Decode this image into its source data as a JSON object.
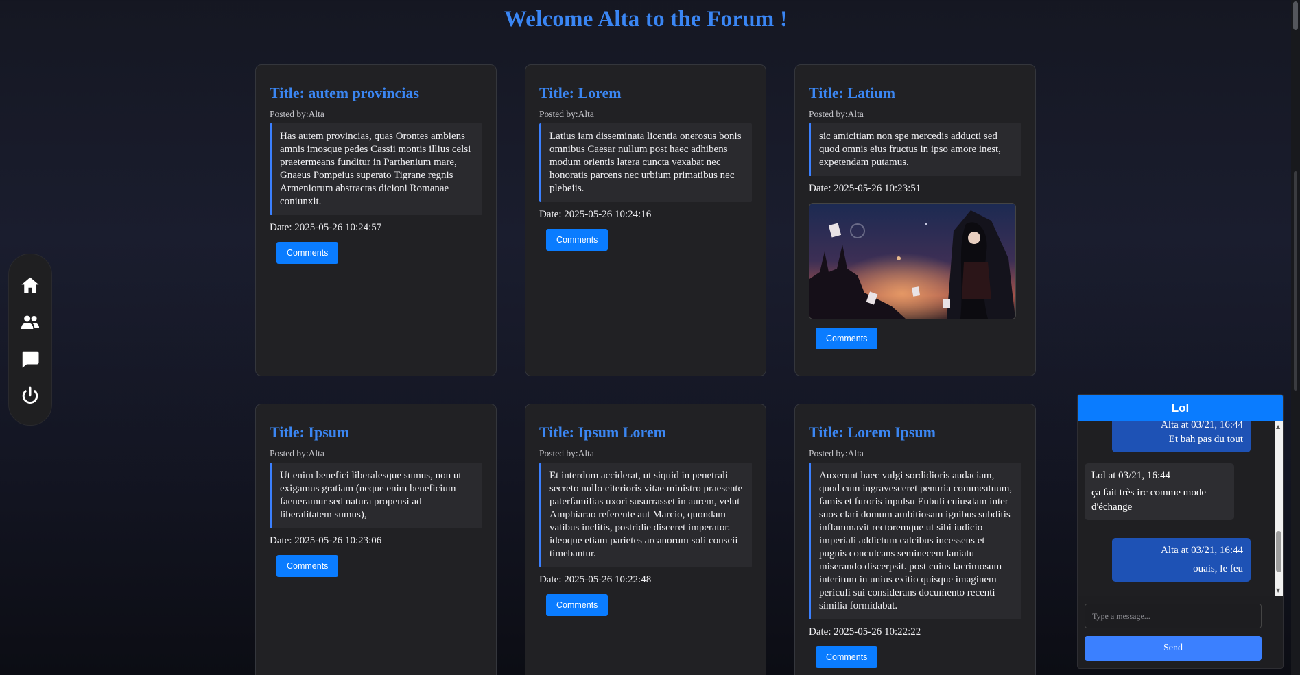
{
  "page": {
    "title": "Welcome Alta to the Forum !"
  },
  "sidebar": {
    "items": [
      {
        "icon": "home-icon"
      },
      {
        "icon": "users-icon"
      },
      {
        "icon": "chat-bubble-icon"
      },
      {
        "icon": "power-icon"
      }
    ]
  },
  "posts": [
    {
      "title": "Title: autem provincias",
      "author": "Posted by:Alta",
      "content": "Has autem provincias, quas Orontes ambiens amnis imosque pedes Cassii montis illius celsi praetermeans funditur in Parthenium mare, Gnaeus Pompeius superato Tigrane regnis Armeniorum abstractas dicioni Romanae coniunxit.",
      "date": "Date: 2025-05-26 10:24:57",
      "button": "Comments"
    },
    {
      "title": "Title: Lorem",
      "author": "Posted by:Alta",
      "content": "Latius iam disseminata licentia onerosus bonis omnibus Caesar nullum post haec adhibens modum orientis latera cuncta vexabat nec honoratis parcens nec urbium primatibus nec plebeiis.",
      "date": "Date: 2025-05-26 10:24:16",
      "button": "Comments"
    },
    {
      "title": "Title: Latium",
      "author": "Posted by:Alta",
      "content": "sic amicitiam non spe mercedis adducti sed quod omnis eius fructus in ipso amore inest, expetendam putamus.",
      "date": "Date: 2025-05-26 10:23:51",
      "button": "Comments"
    },
    {
      "title": "Title: Ipsum",
      "author": "Posted by:Alta",
      "content": "Ut enim benefici liberalesque sumus, non ut exigamus gratiam (neque enim beneficium faeneramur sed natura propensi ad liberalitatem sumus),",
      "date": "Date: 2025-05-26 10:23:06",
      "button": "Comments"
    },
    {
      "title": "Title: Ipsum Lorem",
      "author": "Posted by:Alta",
      "content": "Et interdum acciderat, ut siquid in penetrali secreto nullo citerioris vitae ministro praesente paterfamilias uxori susurrasset in aurem, velut Amphiarao referente aut Marcio, quondam vatibus inclitis, postridie disceret imperator. ideoque etiam parietes arcanorum soli conscii timebantur.",
      "date": "Date: 2025-05-26 10:22:48",
      "button": "Comments"
    },
    {
      "title": "Title: Lorem Ipsum",
      "author": "Posted by:Alta",
      "content": "Auxerunt haec vulgi sordidioris audaciam, quod cum ingravesceret penuria commeatuum, famis et furoris inpulsu Eubuli cuiusdam inter suos clari domum ambitiosam ignibus subditis inflammavit rectoremque ut sibi iudicio imperiali addictum calcibus incessens et pugnis conculcans seminecem laniatu miserando discerpsit. post cuius lacrimosum interitum in unius exitio quisque imaginem periculi sui considerans documento recenti similia formidabat.",
      "date": "Date: 2025-05-26 10:22:22",
      "button": "Comments"
    }
  ],
  "chat": {
    "title": "Lol",
    "messages": [
      {
        "meta": "Alta at 03/21, 16:44",
        "text": "Et bah pas du tout"
      },
      {
        "meta": "Lol at 03/21, 16:44",
        "text": "ça fait très irc comme mode d'échange"
      },
      {
        "meta": "Alta at 03/21, 16:44",
        "text": "ouais, le feu"
      }
    ],
    "input_placeholder": "Type a message...",
    "send_label": "Send"
  }
}
